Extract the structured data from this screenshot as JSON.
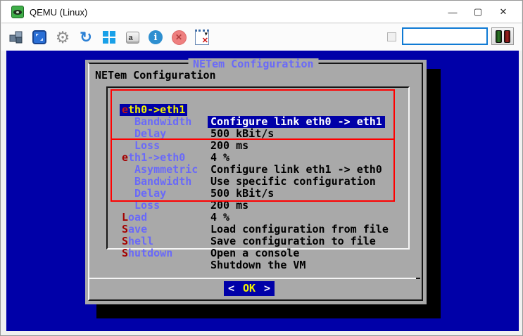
{
  "window": {
    "title": "QEMU (Linux)",
    "controls": {
      "minimize": "—",
      "maximize": "▢",
      "close": "✕"
    }
  },
  "toolbar": {
    "icons": [
      {
        "name": "vm-cubes-icon",
        "glyph": ""
      },
      {
        "name": "fullscreen-icon",
        "glyph": ""
      },
      {
        "name": "settings-gear-icon",
        "glyph": "⚙"
      },
      {
        "name": "refresh-icon",
        "glyph": "↻"
      },
      {
        "name": "windows-logo-icon",
        "glyph": ""
      },
      {
        "name": "keycap-a-icon",
        "glyph": "a"
      },
      {
        "name": "info-icon",
        "glyph": "i"
      },
      {
        "name": "quit-icon",
        "glyph": "✕"
      },
      {
        "name": "shutdown-vm-icon",
        "arrow": "▾",
        "badge": "✕"
      }
    ],
    "input_value": ""
  },
  "dialog": {
    "box_title": "NETem Configuration",
    "heading": "NETem Configuration",
    "menu": {
      "selected_index": 0,
      "items": [
        {
          "hot": "e",
          "rest": "th0->eth1",
          "desc": "Configure link eth0 -> eth1",
          "indent": 0,
          "selected": true
        },
        {
          "hot": "",
          "rest": "Bandwidth",
          "desc": "500 kBit/s",
          "indent": 1
        },
        {
          "hot": "",
          "rest": "Delay",
          "desc": "200 ms",
          "indent": 1
        },
        {
          "hot": "",
          "rest": "Loss",
          "desc": "4 %",
          "indent": 1
        },
        {
          "hot": "e",
          "rest": "th1->eth0",
          "desc": "Configure link eth1 -> eth0",
          "indent": 0
        },
        {
          "hot": "",
          "rest": "Asymmetric",
          "desc": "Use specific configuration",
          "indent": 1
        },
        {
          "hot": "",
          "rest": "Bandwidth",
          "desc": "500 kBit/s",
          "indent": 1
        },
        {
          "hot": "",
          "rest": "Delay",
          "desc": "200 ms",
          "indent": 1
        },
        {
          "hot": "",
          "rest": "Loss",
          "desc": "4 %",
          "indent": 1
        },
        {
          "hot": "L",
          "rest": "oad",
          "desc": "Load configuration from file",
          "indent": 0
        },
        {
          "hot": "S",
          "rest": "ave",
          "desc": "Save configuration to file",
          "indent": 0
        },
        {
          "hot": "S",
          "rest": "hell",
          "desc": "Open a console",
          "indent": 0
        },
        {
          "hot": "S",
          "rest": "hutdown",
          "desc": "Shutdown the VM",
          "indent": 0
        }
      ]
    },
    "ok": {
      "left": "<",
      "label": "OK",
      "right": ">"
    }
  },
  "annotations": {
    "color": "#ff0000",
    "boxes": [
      "link-eth0-eth1-group",
      "link-eth1-eth0-group"
    ]
  },
  "colors": {
    "screen_blue": "#0000A8",
    "dialog_gray": "#A9A9A9",
    "item_blue": "#6a6af8",
    "hotkey_red": "#a40000",
    "highlight_yellow": "#f2f200",
    "annotation_red": "#ff0000",
    "input_border_blue": "#0f7ad4"
  }
}
